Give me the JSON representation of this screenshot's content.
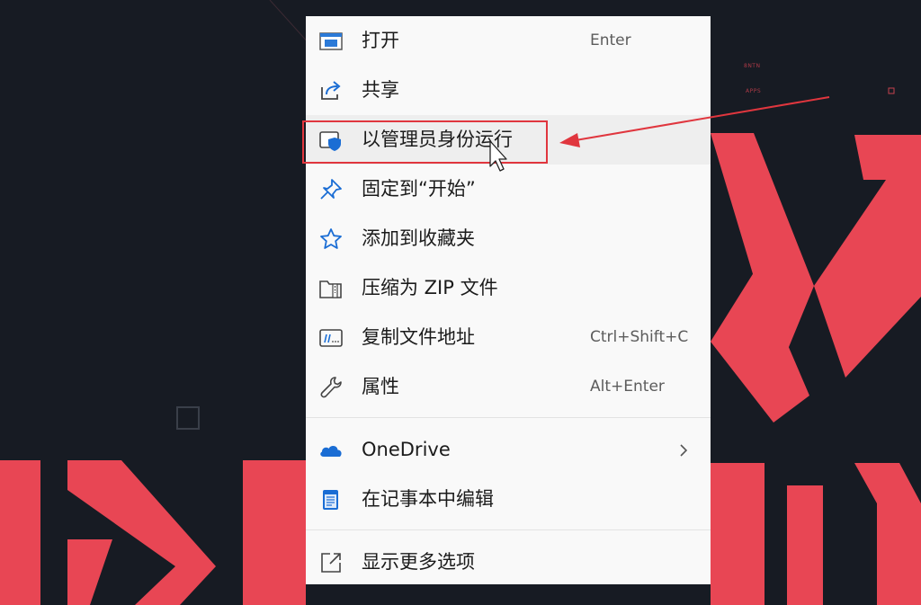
{
  "colors": {
    "background": "#171b23",
    "background_accent": "#e84654",
    "menu_background": "#f9f9f9",
    "highlight": "#e0363e",
    "icon_blue": "#1a6dd4"
  },
  "menu": {
    "items": [
      {
        "label": "打开",
        "shortcut": "Enter",
        "icon": "open-app-icon"
      },
      {
        "label": "共享",
        "shortcut": "",
        "icon": "share-icon"
      },
      {
        "label": "以管理员身份运行",
        "shortcut": "",
        "icon": "shield-run-as-admin-icon"
      },
      {
        "label": "固定到“开始”",
        "shortcut": "",
        "icon": "pin-icon"
      },
      {
        "label": "添加到收藏夹",
        "shortcut": "",
        "icon": "star-icon"
      },
      {
        "label": "压缩为 ZIP 文件",
        "shortcut": "",
        "icon": "zip-folder-icon"
      },
      {
        "label": "复制文件地址",
        "shortcut": "Ctrl+Shift+C",
        "icon": "copy-path-icon"
      },
      {
        "label": "属性",
        "shortcut": "Alt+Enter",
        "icon": "wrench-icon"
      },
      {
        "label": "OneDrive",
        "shortcut": "",
        "icon": "onedrive-cloud-icon",
        "submenu": true
      },
      {
        "label": "在记事本中编辑",
        "shortcut": "",
        "icon": "notepad-icon"
      },
      {
        "label": "显示更多选项",
        "shortcut": "",
        "icon": "show-more-options-icon"
      }
    ]
  },
  "background": {
    "hud_text_1": "8NTN",
    "hud_text_2": "APPS"
  }
}
